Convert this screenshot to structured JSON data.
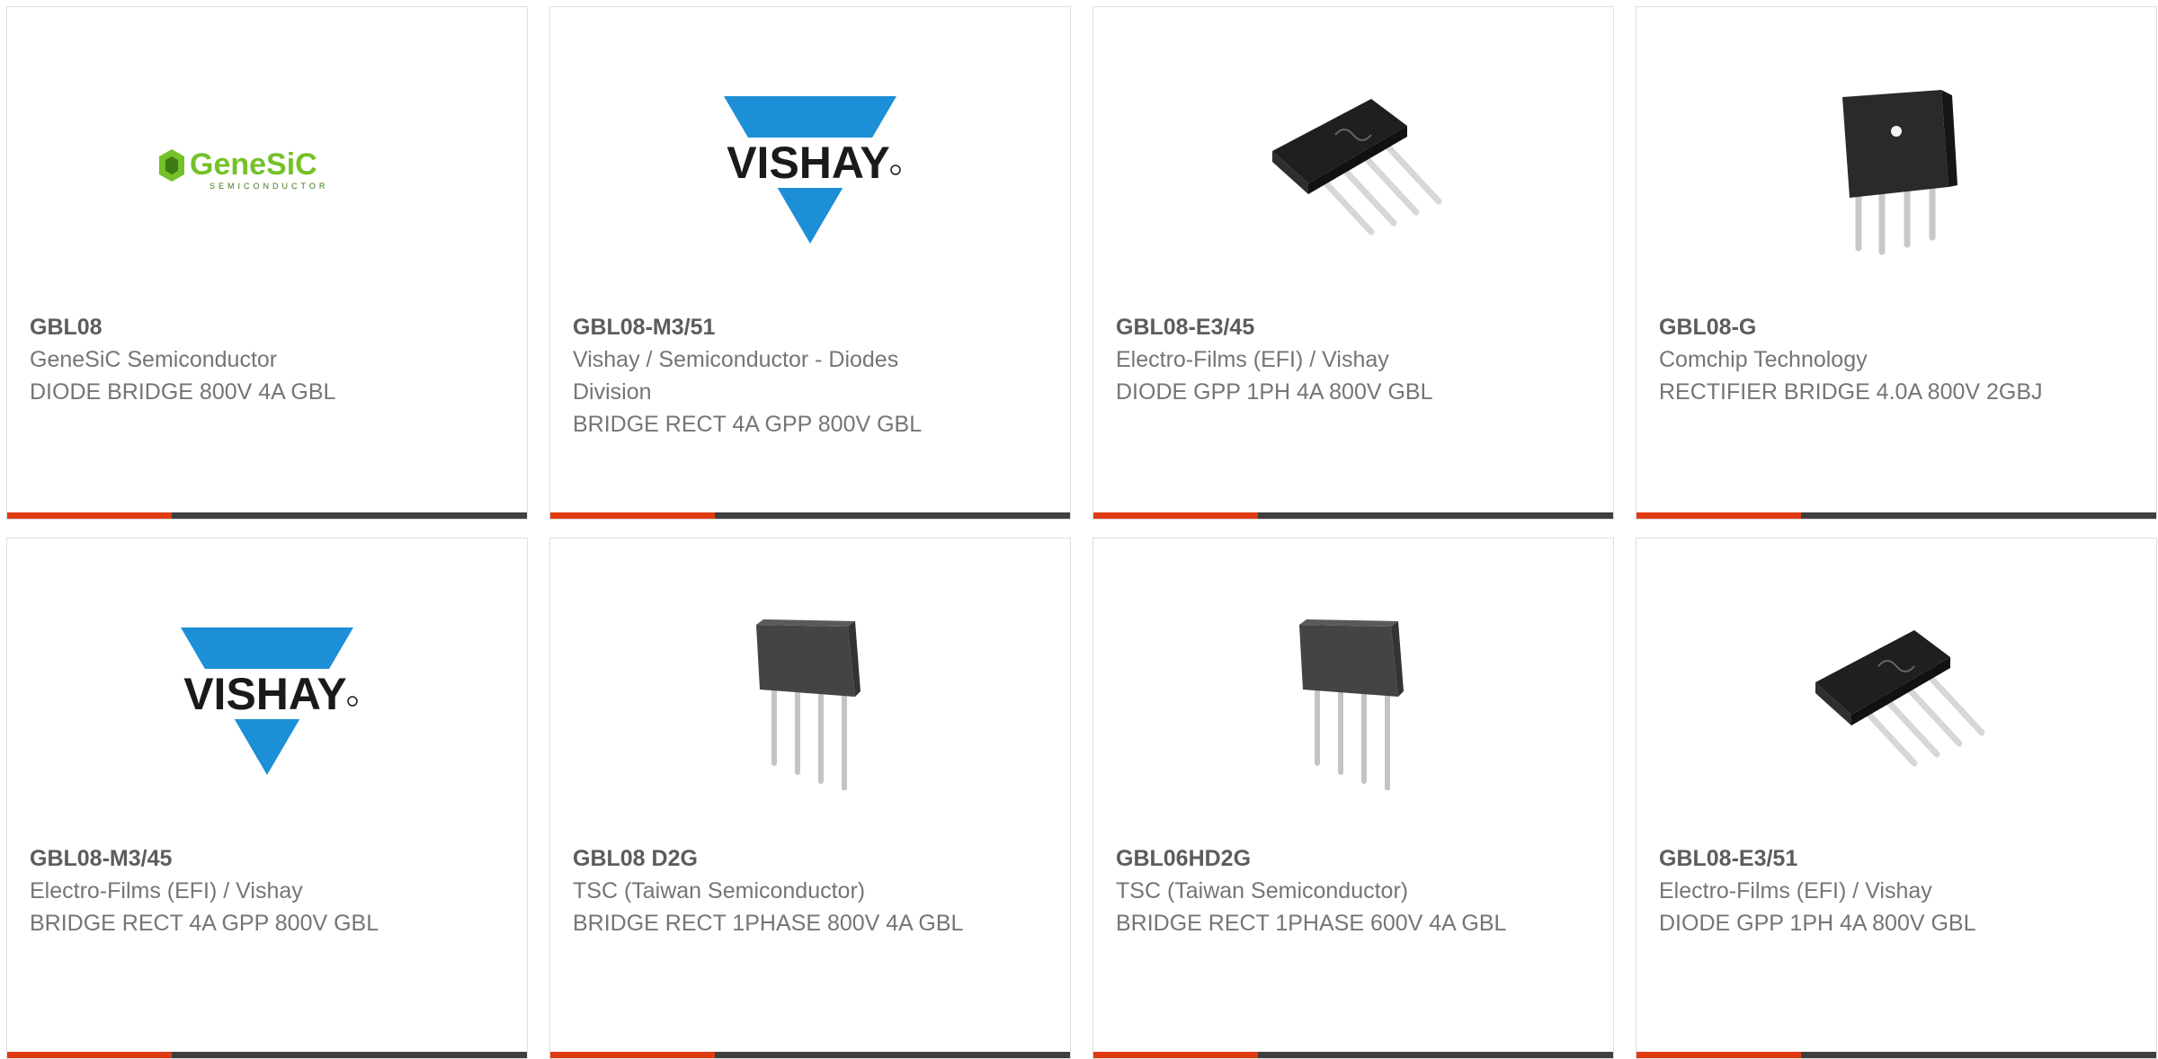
{
  "theme": {
    "accent": "#e03c14",
    "bar": "#3f3f3f",
    "vishay_blue": "#1d8fd6",
    "genesic_green": "#74c12a"
  },
  "products": [
    {
      "part_number": "GBL08",
      "manufacturer": "GeneSiC Semiconductor",
      "description": "DIODE BRIDGE 800V 4A GBL",
      "image": "genesic-logo",
      "logo_text": "GeneSiC",
      "logo_subtext": "SEMICONDUCTOR"
    },
    {
      "part_number": "GBL08-M3/51",
      "manufacturer": "Vishay / Semiconductor - Diodes Division",
      "description": "BRIDGE RECT 4A GPP 800V GBL",
      "image": "vishay-logo",
      "logo_text": "VISHAY"
    },
    {
      "part_number": "GBL08-E3/45",
      "manufacturer": "Electro-Films (EFI) / Vishay",
      "description": "DIODE GPP 1PH 4A 800V GBL",
      "image": "bridge-rectifier-angled"
    },
    {
      "part_number": "GBL08-G",
      "manufacturer": "Comchip Technology",
      "description": "RECTIFIER BRIDGE 4.0A 800V 2GBJ",
      "image": "bridge-rectifier-hole"
    },
    {
      "part_number": "GBL08-M3/45",
      "manufacturer": "Electro-Films (EFI) / Vishay",
      "description": "BRIDGE RECT 4A GPP 800V GBL",
      "image": "vishay-logo",
      "logo_text": "VISHAY"
    },
    {
      "part_number": "GBL08 D2G",
      "manufacturer": "TSC (Taiwan Semiconductor)",
      "description": "BRIDGE RECT 1PHASE 800V 4A GBL",
      "image": "bridge-rectifier-flat"
    },
    {
      "part_number": "GBL06HD2G",
      "manufacturer": "TSC (Taiwan Semiconductor)",
      "description": "BRIDGE RECT 1PHASE 600V 4A GBL",
      "image": "bridge-rectifier-flat"
    },
    {
      "part_number": "GBL08-E3/51",
      "manufacturer": "Electro-Films (EFI) / Vishay",
      "description": "DIODE GPP 1PH 4A 800V GBL",
      "image": "bridge-rectifier-angled"
    }
  ]
}
